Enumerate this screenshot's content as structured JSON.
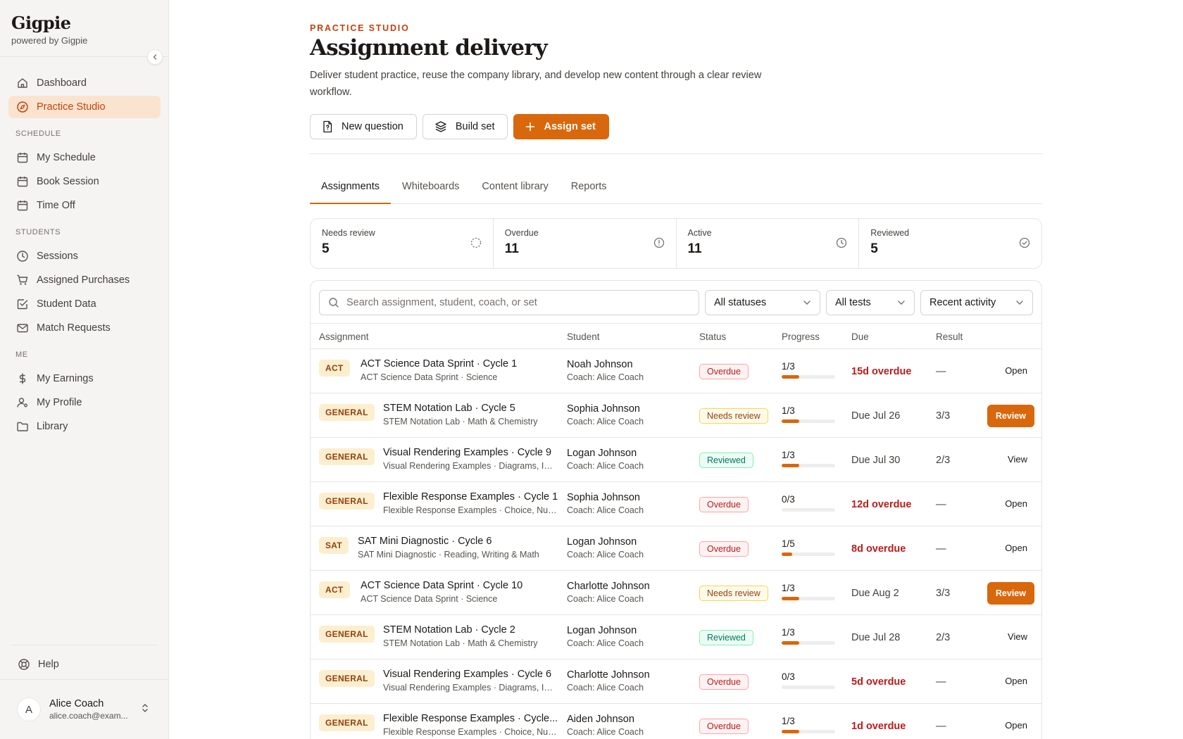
{
  "brand": {
    "name": "Gigpie",
    "tagline": "powered by Gigpie"
  },
  "nav": {
    "top": [
      {
        "label": "Dashboard",
        "icon": "home-icon"
      },
      {
        "label": "Practice Studio",
        "icon": "compass-icon",
        "active": true
      }
    ],
    "schedule_title": "SCHEDULE",
    "schedule": [
      {
        "label": "My Schedule",
        "icon": "calendar-icon"
      },
      {
        "label": "Book Session",
        "icon": "calendar-icon"
      },
      {
        "label": "Time Off",
        "icon": "calendar-icon"
      }
    ],
    "students_title": "STUDENTS",
    "students": [
      {
        "label": "Sessions",
        "icon": "clock-icon"
      },
      {
        "label": "Assigned Purchases",
        "icon": "cart-icon"
      },
      {
        "label": "Student Data",
        "icon": "checkbox-icon"
      },
      {
        "label": "Match Requests",
        "icon": "mail-icon"
      }
    ],
    "me_title": "ME",
    "me": [
      {
        "label": "My Earnings",
        "icon": "dollar-icon"
      },
      {
        "label": "My Profile",
        "icon": "user-icon"
      },
      {
        "label": "Library",
        "icon": "folder-icon"
      }
    ],
    "help": "Help"
  },
  "user": {
    "initial": "A",
    "name": "Alice Coach",
    "email": "alice.coach@exam..."
  },
  "header": {
    "eyebrow": "PRACTICE STUDIO",
    "title": "Assignment delivery",
    "description": "Deliver student practice, reuse the company library, and develop new content through a clear review workflow."
  },
  "actions": {
    "new_question": "New question",
    "build_set": "Build set",
    "assign_set": "Assign set"
  },
  "tabs": [
    "Assignments",
    "Whiteboards",
    "Content library",
    "Reports"
  ],
  "stats": [
    {
      "label": "Needs review",
      "value": "5",
      "icon": "loader-icon"
    },
    {
      "label": "Overdue",
      "value": "11",
      "icon": "alert-circle-icon"
    },
    {
      "label": "Active",
      "value": "11",
      "icon": "clock-icon"
    },
    {
      "label": "Reviewed",
      "value": "5",
      "icon": "check-circle-icon"
    }
  ],
  "filters": {
    "search_placeholder": "Search assignment, student, coach, or set",
    "status": "All statuses",
    "tests": "All tests",
    "sort": "Recent activity"
  },
  "columns": [
    "Assignment",
    "Student",
    "Status",
    "Progress",
    "Due",
    "Result"
  ],
  "rows": [
    {
      "tag": "ACT",
      "title": "ACT Science Data Sprint · Cycle 1",
      "subtitle": "ACT Science Data Sprint · Science",
      "student": "Noah Johnson",
      "coach": "Coach: Alice Coach",
      "status": "Overdue",
      "status_kind": "overdue",
      "progress": "1/3",
      "progress_pct": 33,
      "due": "15d overdue",
      "due_overdue": true,
      "result": "—",
      "action": "Open",
      "action_primary": false
    },
    {
      "tag": "GENERAL",
      "title": "STEM Notation Lab · Cycle 5",
      "subtitle": "STEM Notation Lab · Math & Chemistry",
      "student": "Sophia Johnson",
      "coach": "Coach: Alice Coach",
      "status": "Needs review",
      "status_kind": "review",
      "progress": "1/3",
      "progress_pct": 33,
      "due": "Due Jul 26",
      "due_overdue": false,
      "result": "3/3",
      "action": "Review",
      "action_primary": true
    },
    {
      "tag": "GENERAL",
      "title": "Visual Rendering Examples · Cycle 9",
      "subtitle": "Visual Rendering Examples · Diagrams, Im...",
      "student": "Logan Johnson",
      "coach": "Coach: Alice Coach",
      "status": "Reviewed",
      "status_kind": "reviewed",
      "progress": "1/3",
      "progress_pct": 33,
      "due": "Due Jul 30",
      "due_overdue": false,
      "result": "2/3",
      "action": "View",
      "action_primary": false
    },
    {
      "tag": "GENERAL",
      "title": "Flexible Response Examples · Cycle 1",
      "subtitle": "Flexible Response Examples · Choice, Num...",
      "student": "Sophia Johnson",
      "coach": "Coach: Alice Coach",
      "status": "Overdue",
      "status_kind": "overdue",
      "progress": "0/3",
      "progress_pct": 0,
      "due": "12d overdue",
      "due_overdue": true,
      "result": "—",
      "action": "Open",
      "action_primary": false
    },
    {
      "tag": "SAT",
      "title": "SAT Mini Diagnostic · Cycle 6",
      "subtitle": "SAT Mini Diagnostic · Reading, Writing & Math",
      "student": "Logan Johnson",
      "coach": "Coach: Alice Coach",
      "status": "Overdue",
      "status_kind": "overdue",
      "progress": "1/5",
      "progress_pct": 20,
      "due": "8d overdue",
      "due_overdue": true,
      "result": "—",
      "action": "Open",
      "action_primary": false
    },
    {
      "tag": "ACT",
      "title": "ACT Science Data Sprint · Cycle 10",
      "subtitle": "ACT Science Data Sprint · Science",
      "student": "Charlotte Johnson",
      "coach": "Coach: Alice Coach",
      "status": "Needs review",
      "status_kind": "review",
      "progress": "1/3",
      "progress_pct": 33,
      "due": "Due Aug 2",
      "due_overdue": false,
      "result": "3/3",
      "action": "Review",
      "action_primary": true
    },
    {
      "tag": "GENERAL",
      "title": "STEM Notation Lab · Cycle 2",
      "subtitle": "STEM Notation Lab · Math & Chemistry",
      "student": "Logan Johnson",
      "coach": "Coach: Alice Coach",
      "status": "Reviewed",
      "status_kind": "reviewed",
      "progress": "1/3",
      "progress_pct": 33,
      "due": "Due Jul 28",
      "due_overdue": false,
      "result": "2/3",
      "action": "View",
      "action_primary": false
    },
    {
      "tag": "GENERAL",
      "title": "Visual Rendering Examples · Cycle 6",
      "subtitle": "Visual Rendering Examples · Diagrams, Im...",
      "student": "Charlotte Johnson",
      "coach": "Coach: Alice Coach",
      "status": "Overdue",
      "status_kind": "overdue",
      "progress": "0/3",
      "progress_pct": 0,
      "due": "5d overdue",
      "due_overdue": true,
      "result": "—",
      "action": "Open",
      "action_primary": false
    },
    {
      "tag": "GENERAL",
      "title": "Flexible Response Examples · Cycle...",
      "subtitle": "Flexible Response Examples · Choice, Num...",
      "student": "Aiden Johnson",
      "coach": "Coach: Alice Coach",
      "status": "Overdue",
      "status_kind": "overdue",
      "progress": "1/3",
      "progress_pct": 33,
      "due": "1d overdue",
      "due_overdue": true,
      "result": "—",
      "action": "Open",
      "action_primary": false
    }
  ],
  "colors": {
    "accent": "#d9670b",
    "accent_soft": "#fbe4cf",
    "danger": "#b91c1c",
    "success": "#047857"
  }
}
